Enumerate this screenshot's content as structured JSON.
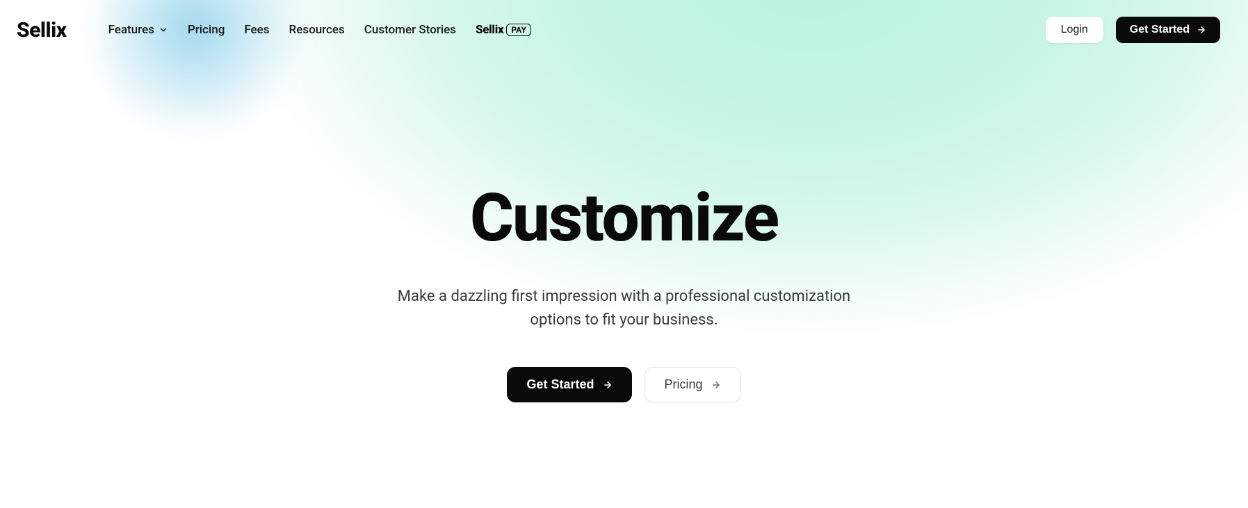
{
  "brand": {
    "logo": "Sellix",
    "pay_text": "Sellix",
    "pay_badge": "PAY"
  },
  "nav": {
    "features": "Features",
    "pricing": "Pricing",
    "fees": "Fees",
    "resources": "Resources",
    "customer_stories": "Customer Stories",
    "login": "Login",
    "get_started": "Get Started"
  },
  "hero": {
    "title": "Customize",
    "subtitle": "Make a dazzling first impression with a professional customization options to fit your business.",
    "primary_cta": "Get Started",
    "secondary_cta": "Pricing"
  }
}
